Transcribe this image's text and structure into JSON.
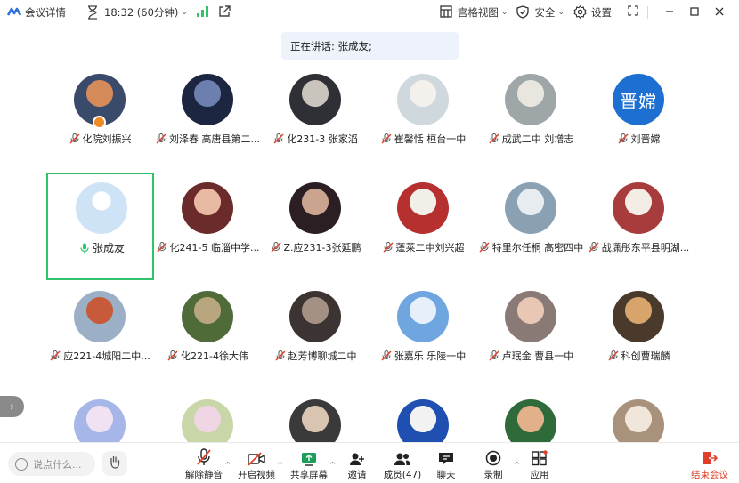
{
  "topbar": {
    "meeting_details": "会议详情",
    "time": "18:32 (60分钟)",
    "layout": "宫格视图",
    "security": "安全",
    "settings": "设置"
  },
  "speaking_banner": "正在讲话: 张成友;",
  "participants": [
    {
      "name": "化院刘振兴",
      "host": true
    },
    {
      "name": "刘泽春 高唐县第二..."
    },
    {
      "name": "化231-3 张家滔"
    },
    {
      "name": "崔馨恬 桓台一中"
    },
    {
      "name": "成武二中 刘增志"
    },
    {
      "name": "刘晋嫦",
      "avatar_text": "晋嫦"
    },
    {
      "name": "张成友",
      "active": true,
      "speaking": true
    },
    {
      "name": "化241-5 临淄中学..."
    },
    {
      "name": "Z.应231-3张延鹏"
    },
    {
      "name": "蓬莱二中刘兴超"
    },
    {
      "name": "特里尔任桐 高密四中"
    },
    {
      "name": "战潇彤东平县明湖..."
    },
    {
      "name": "应221-4城阳二中..."
    },
    {
      "name": "化221-4徐大伟"
    },
    {
      "name": "赵芳博聊城二中"
    },
    {
      "name": "张嘉乐 乐陵一中"
    },
    {
      "name": "卢珉金 曹县一中"
    },
    {
      "name": "科创曹瑞麟"
    },
    {
      "name": ""
    },
    {
      "name": ""
    },
    {
      "name": ""
    },
    {
      "name": ""
    },
    {
      "name": ""
    },
    {
      "name": ""
    }
  ],
  "bottombar": {
    "chat_placeholder": "说点什么...",
    "unmute": "解除静音",
    "start_video": "开启视频",
    "share_screen": "共享屏幕",
    "invite": "邀请",
    "members": "成员(47)",
    "chat": "聊天",
    "record": "录制",
    "apps": "应用",
    "end_meeting": "结束会议"
  },
  "colors": {
    "accent_green": "#2fc46b",
    "end_red": "#e0402b",
    "mute_red": "#e0402b",
    "avatar_blue": "#1d6fd1",
    "banner_bg": "#eef2fb"
  }
}
